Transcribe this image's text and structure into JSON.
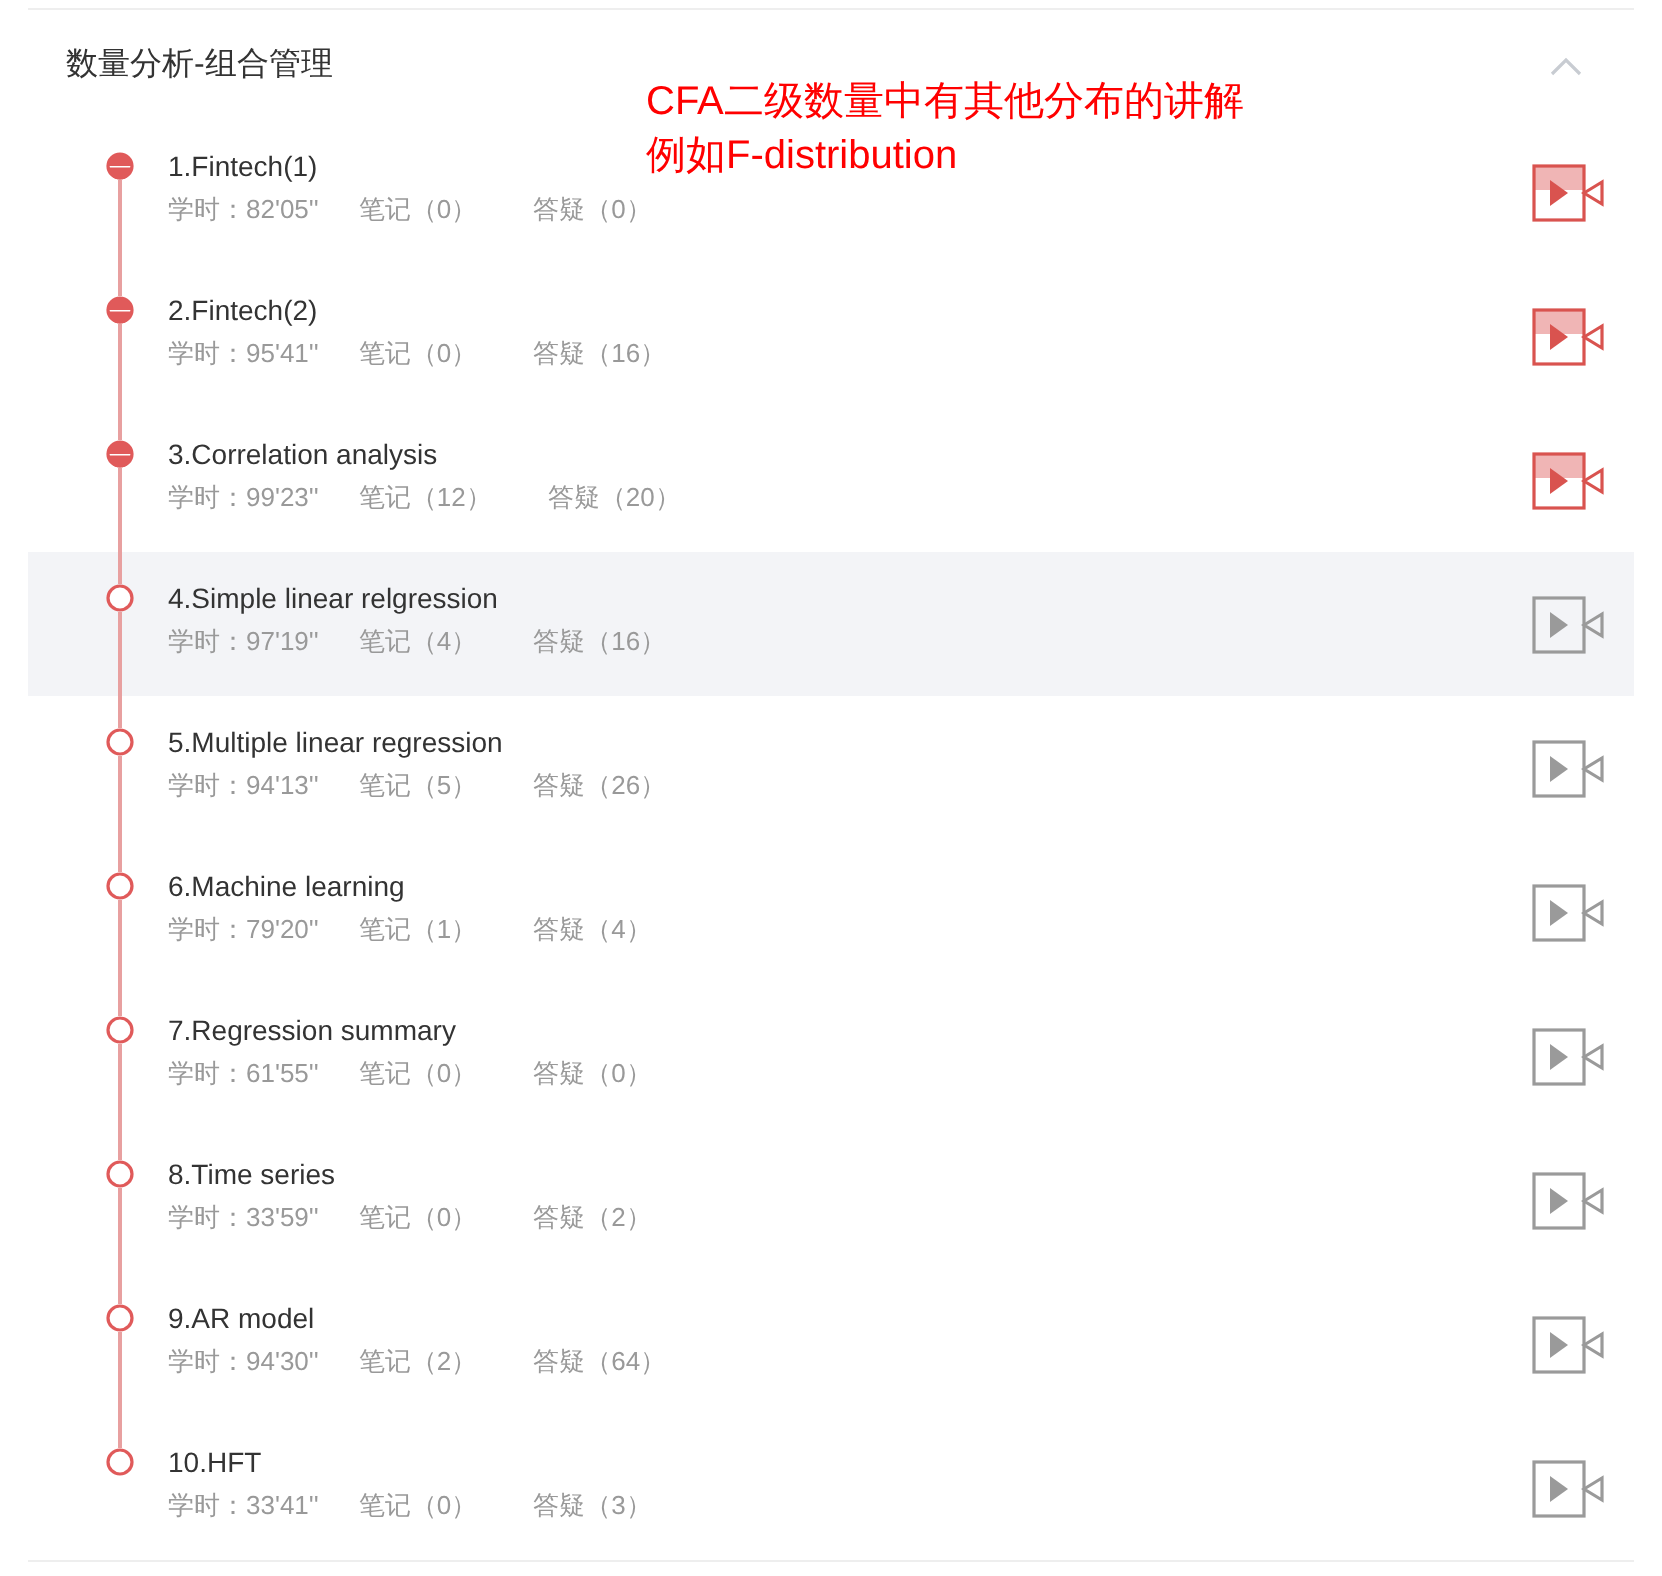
{
  "section": {
    "title": "数量分析-组合管理",
    "expanded": true
  },
  "annotation": {
    "lines": [
      "CFA二级数量中有其他分布的讲解",
      "例如F-distribution"
    ]
  },
  "lessons": [
    {
      "title": "1.Fintech(1)",
      "duration": "学时：82'05''",
      "notes": "笔记（0）",
      "questions": "答疑（0）",
      "started": true,
      "selected": false
    },
    {
      "title": "2.Fintech(2)",
      "duration": "学时：95'41''",
      "notes": "笔记（0）",
      "questions": "答疑（16）",
      "started": true,
      "selected": false
    },
    {
      "title": "3.Correlation analysis",
      "duration": "学时：99'23''",
      "notes": "笔记（12）",
      "questions": "答疑（20）",
      "started": true,
      "selected": false
    },
    {
      "title": "4.Simple linear relgression",
      "duration": "学时：97'19''",
      "notes": "笔记（4）",
      "questions": "答疑（16）",
      "started": false,
      "selected": true
    },
    {
      "title": "5.Multiple linear regression",
      "duration": "学时：94'13''",
      "notes": "笔记（5）",
      "questions": "答疑（26）",
      "started": false,
      "selected": false
    },
    {
      "title": "6.Machine learning",
      "duration": "学时：79'20''",
      "notes": "笔记（1）",
      "questions": "答疑（4）",
      "started": false,
      "selected": false
    },
    {
      "title": "7.Regression summary",
      "duration": "学时：61'55''",
      "notes": "笔记（0）",
      "questions": "答疑（0）",
      "started": false,
      "selected": false
    },
    {
      "title": "8.Time series",
      "duration": "学时：33'59''",
      "notes": "笔记（0）",
      "questions": "答疑（2）",
      "started": false,
      "selected": false
    },
    {
      "title": "9.AR model",
      "duration": "学时：94'30''",
      "notes": "笔记（2）",
      "questions": "答疑（64）",
      "started": false,
      "selected": false
    },
    {
      "title": "10.HFT",
      "duration": "学时：33'41''",
      "notes": "笔记（0）",
      "questions": "答疑（3）",
      "started": false,
      "selected": false
    }
  ]
}
